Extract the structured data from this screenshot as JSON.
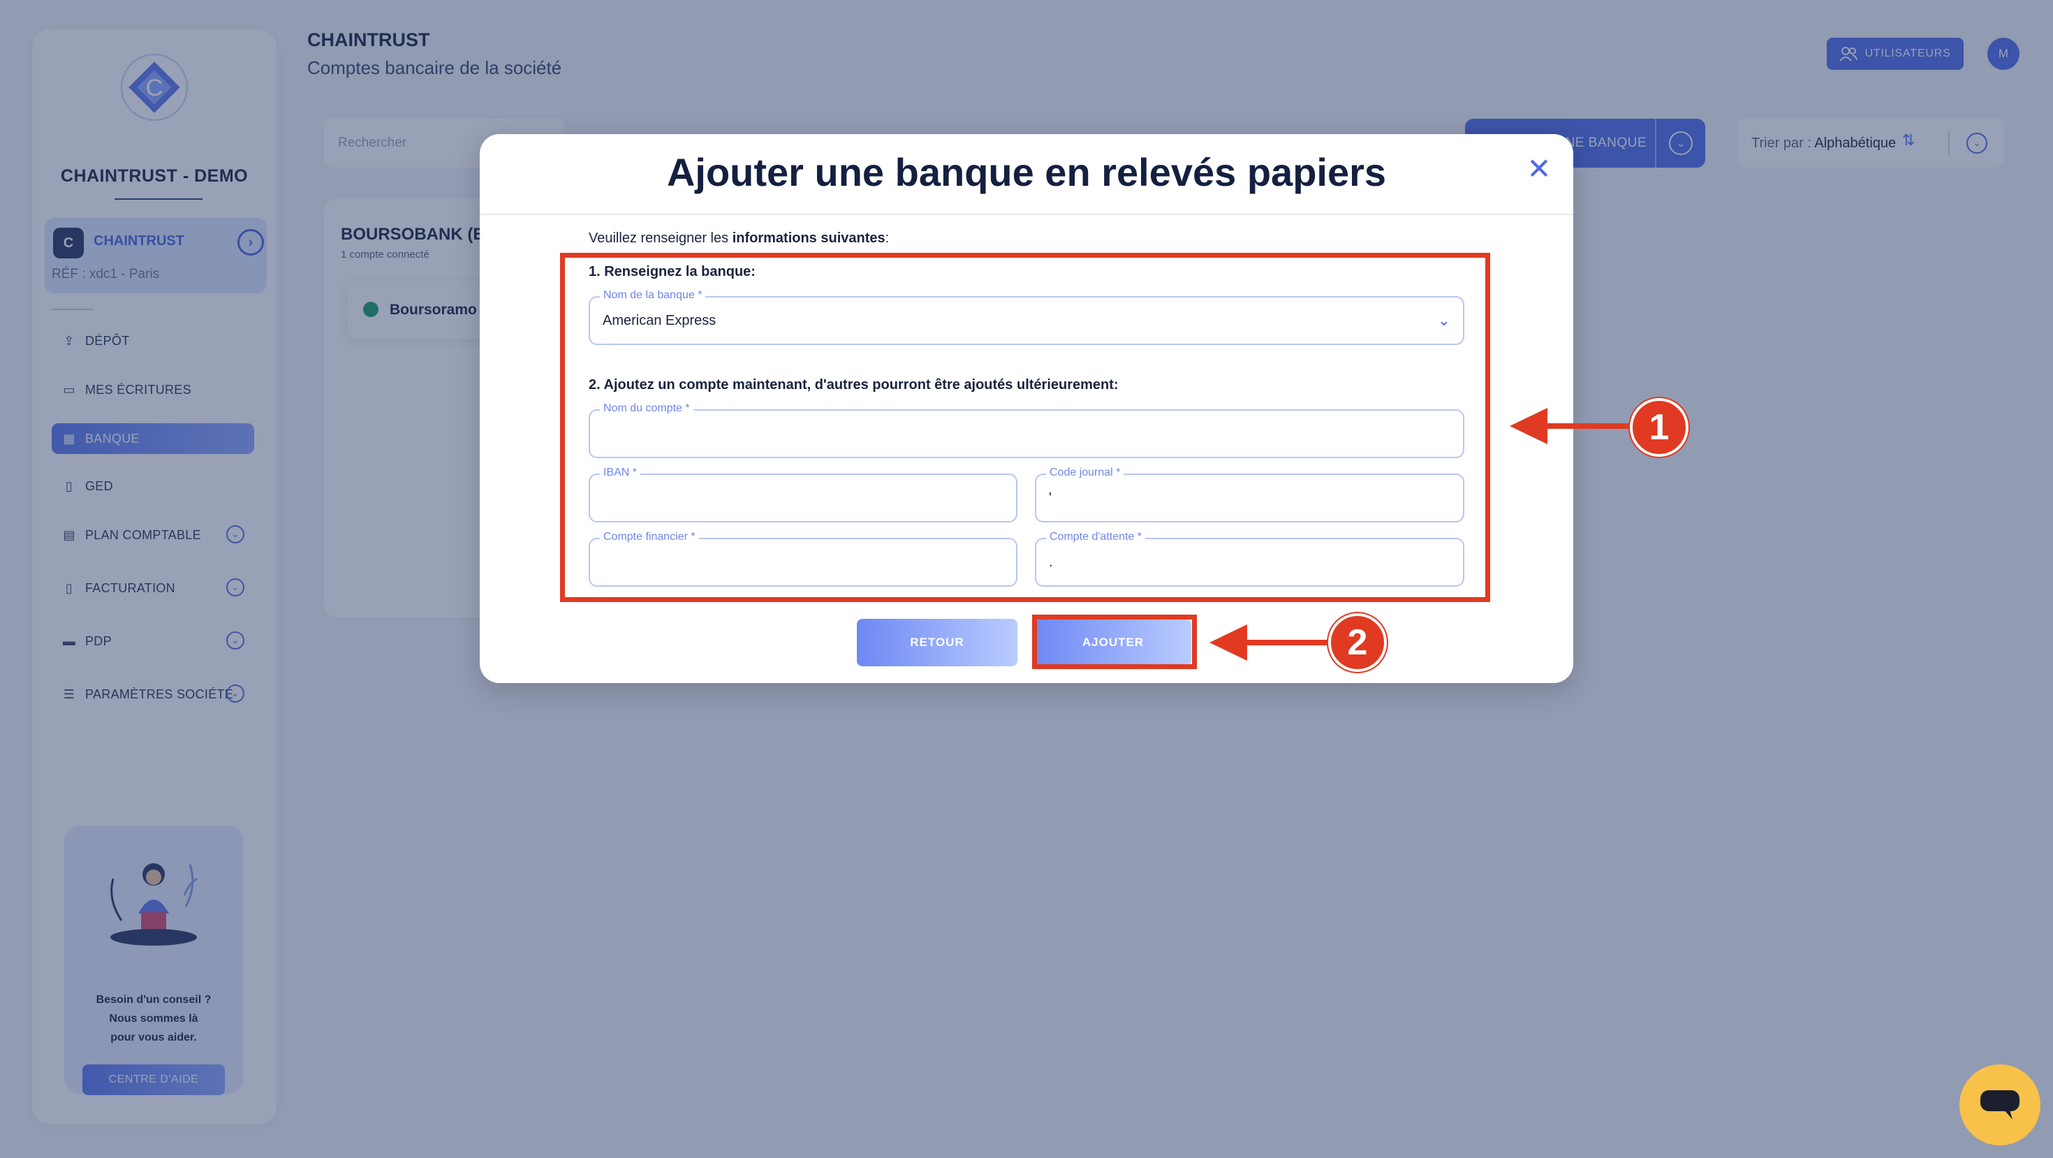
{
  "app": {
    "company_name": "CHAINTRUST - DEMO"
  },
  "sidebar": {
    "org": {
      "name": "CHAINTRUST",
      "ref": "RÉF : xdc1 - Paris"
    },
    "items": [
      {
        "label": "DÉPÔT",
        "icon": "upload-icon",
        "active": false,
        "expandable": false
      },
      {
        "label": "MES ÉCRITURES",
        "icon": "entries-icon",
        "active": false,
        "expandable": false
      },
      {
        "label": "BANQUE",
        "icon": "bank-icon",
        "active": true,
        "expandable": false
      },
      {
        "label": "GED",
        "icon": "document-icon",
        "active": false,
        "expandable": false
      },
      {
        "label": "PLAN COMPTABLE",
        "icon": "ledger-icon",
        "active": false,
        "expandable": true
      },
      {
        "label": "FACTURATION",
        "icon": "invoice-icon",
        "active": false,
        "expandable": true
      },
      {
        "label": "PDP",
        "icon": "card-icon",
        "active": false,
        "expandable": true
      },
      {
        "label": "PARAMÈTRES SOCIÉTÉ",
        "icon": "sliders-icon",
        "active": false,
        "expandable": true
      }
    ],
    "help": {
      "text": "Besoin d'un conseil ?\nNous sommes là\npour vous aider.",
      "button": "CENTRE D'AIDE"
    }
  },
  "header": {
    "title": "CHAINTRUST",
    "subtitle": "Comptes bancaire de la société",
    "users_button": "UTILISATEURS",
    "avatar_initial": "M"
  },
  "toolbar": {
    "search_placeholder": "Rechercher",
    "add_bank_label": "UNE BANQUE",
    "sort_label": "Trier par : ",
    "sort_value": "Alphabétique"
  },
  "bank_card": {
    "title": "BOURSOBANK (EX",
    "subtitle": "1 compte connecté",
    "account_name": "Boursoramo"
  },
  "modal": {
    "title": "Ajouter une banque en relevés papiers",
    "intro_prefix": "Veuillez renseigner les ",
    "intro_bold": "informations suivantes",
    "intro_suffix": ":",
    "step1": "1. Renseignez la banque:",
    "step2": "2. Ajoutez un compte maintenant, d'autres pourront être ajoutés ultérieurement:",
    "fields": {
      "bank_name": {
        "label": "Nom de la banque *",
        "value": "American Express"
      },
      "account_name": {
        "label": "Nom du compte *",
        "value": ""
      },
      "iban": {
        "label": "IBAN *",
        "value": ""
      },
      "journal_code": {
        "label": "Code journal *",
        "value": "'"
      },
      "financial_account": {
        "label": "Compte financier *",
        "value": ""
      },
      "waiting_account": {
        "label": "Compte d'attente *",
        "value": "."
      }
    },
    "back_button": "RETOUR",
    "add_button": "AJOUTER"
  },
  "annotations": {
    "marker1": "1",
    "marker2": "2"
  },
  "colors": {
    "accent": "#4f6be8",
    "annotation": "#e03a22",
    "chat": "#f8c14a"
  }
}
